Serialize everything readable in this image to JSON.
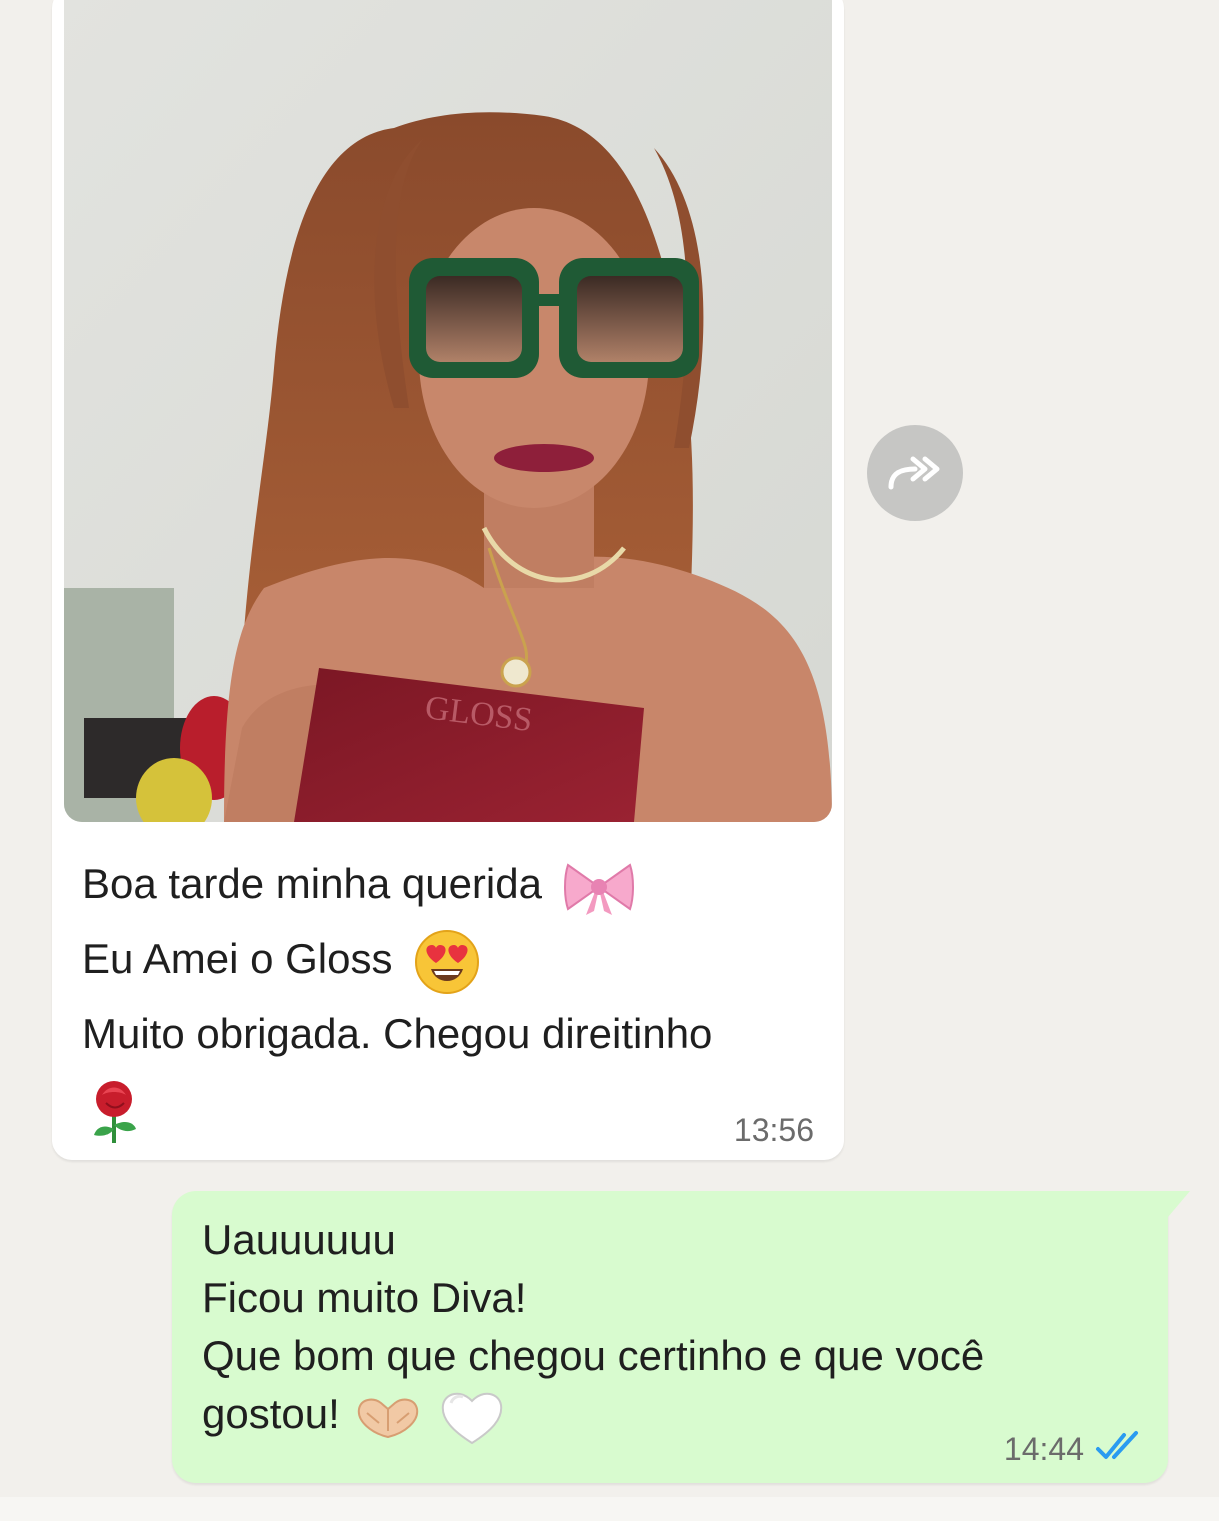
{
  "incoming_message": {
    "caption_lines": [
      "Boa tarde minha querida",
      "Eu Amei o Gloss",
      "Muito obrigada. Chegou direitinho"
    ],
    "emojis": [
      "ribbon-emoji",
      "heart-eyes-emoji",
      "rose-emoji"
    ],
    "photo_box_text": "GLOSS",
    "time": "13:56"
  },
  "forward_button": {
    "icon": "forward-icon"
  },
  "outgoing_message": {
    "lines": [
      "Uauuuuuu",
      "Ficou muito Diva!",
      "Que bom que chegou certinho e que você",
      "gostou!"
    ],
    "emojis": [
      "heart-hands-emoji",
      "white-heart-emoji"
    ],
    "time": "14:44",
    "status": "read",
    "status_icon": "double-check-icon"
  },
  "colors": {
    "chat_background": "#f2f0ec",
    "incoming_bubble": "#ffffff",
    "outgoing_bubble": "#d8fbcf",
    "read_ticks": "#2a9bf0"
  }
}
